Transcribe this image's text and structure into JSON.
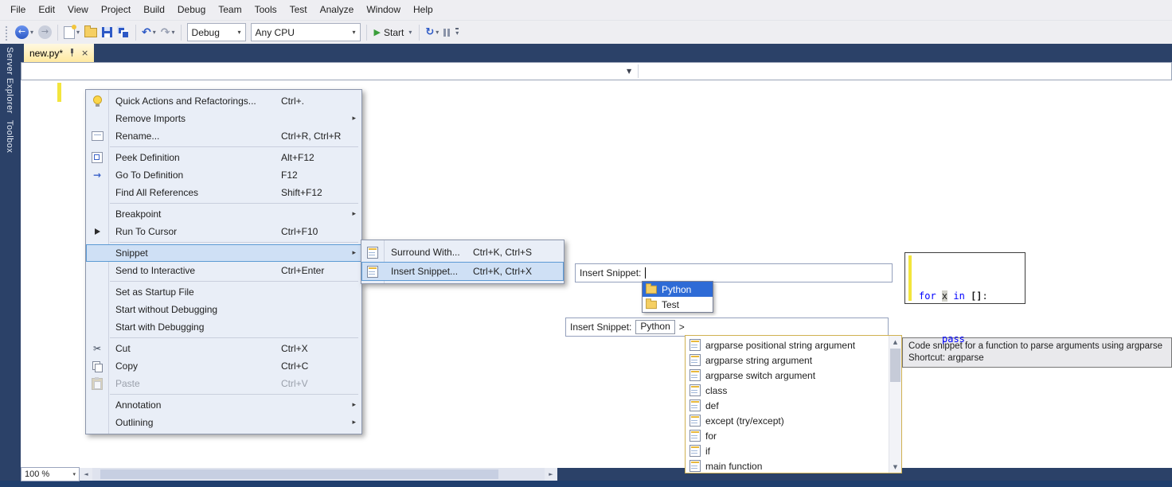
{
  "menubar": {
    "items": [
      "File",
      "Edit",
      "View",
      "Project",
      "Build",
      "Debug",
      "Team",
      "Tools",
      "Test",
      "Analyze",
      "Window",
      "Help"
    ]
  },
  "toolbar": {
    "solution_config": "Debug",
    "platform": "Any CPU",
    "start_label": "Start"
  },
  "side_tabs": {
    "server_explorer": "Server Explorer",
    "toolbox": "Toolbox"
  },
  "document_tab": {
    "title": "new.py*"
  },
  "context_menu": {
    "items": [
      {
        "label": "Quick Actions and Refactorings...",
        "shortcut": "Ctrl+."
      },
      {
        "label": "Remove Imports",
        "has_submenu": true
      },
      {
        "label": "Rename...",
        "shortcut": "Ctrl+R, Ctrl+R"
      },
      {
        "label": "Peek Definition",
        "shortcut": "Alt+F12"
      },
      {
        "label": "Go To Definition",
        "shortcut": "F12"
      },
      {
        "label": "Find All References",
        "shortcut": "Shift+F12"
      },
      {
        "label": "Breakpoint",
        "has_submenu": true
      },
      {
        "label": "Run To Cursor",
        "shortcut": "Ctrl+F10"
      },
      {
        "label": "Snippet",
        "has_submenu": true,
        "selected": true
      },
      {
        "label": "Send to Interactive",
        "shortcut": "Ctrl+Enter"
      },
      {
        "label": "Set as Startup File"
      },
      {
        "label": "Start without Debugging"
      },
      {
        "label": "Start with Debugging"
      },
      {
        "label": "Cut",
        "shortcut": "Ctrl+X"
      },
      {
        "label": "Copy",
        "shortcut": "Ctrl+C"
      },
      {
        "label": "Paste",
        "shortcut": "Ctrl+V",
        "disabled": true
      },
      {
        "label": "Annotation",
        "has_submenu": true
      },
      {
        "label": "Outlining",
        "has_submenu": true
      }
    ]
  },
  "snippet_submenu": {
    "items": [
      {
        "label": "Surround With...",
        "shortcut": "Ctrl+K, Ctrl+S"
      },
      {
        "label": "Insert Snippet...",
        "shortcut": "Ctrl+K, Ctrl+X",
        "selected": true
      }
    ]
  },
  "snippet_picker": {
    "prompt": "Insert Snippet:"
  },
  "snippet_folders": {
    "python": "Python",
    "test": "Test",
    "selected": "Python"
  },
  "snippet_picker_expanded": {
    "prompt": "Insert Snippet:",
    "selected_folder": "Python",
    "chevron": ">"
  },
  "snippet_list": {
    "items": [
      "argparse positional string argument",
      "argparse string argument",
      "argparse switch argument",
      "class",
      "def",
      "except (try/except)",
      "for",
      "if",
      "main function"
    ]
  },
  "snippet_tooltip": {
    "description": "Code snippet for a function to parse arguments using argparse",
    "shortcut": "Shortcut: argparse"
  },
  "code_preview": {
    "kw_for": "for",
    "variable": "x",
    "kw_in": "in",
    "brackets": "[]",
    "colon": ":",
    "kw_pass": "pass"
  },
  "bottom_bar": {
    "zoom": "100 %"
  },
  "colors": {
    "chrome_dark": "#2b4168",
    "toolbar_bg": "#eeeef2",
    "tab_active": "#ffe9a0",
    "menu_highlight": "#cfe0f5",
    "menu_highlight_border": "#5c9ad4",
    "list_selection_blue": "#2e6bd6",
    "keyword_blue": "#0000ff",
    "changed_line_marker": "#f3e53d",
    "start_green": "#3a9e3a"
  }
}
